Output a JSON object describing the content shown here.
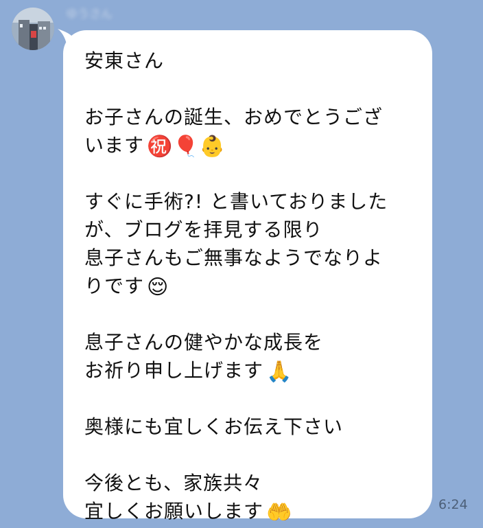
{
  "chat": {
    "sender_name": "ゆうさん",
    "timestamp": "6:24",
    "message_lines": [
      {
        "text": "安東さん",
        "emoji": ""
      },
      {
        "text": "",
        "emoji": ""
      },
      {
        "text": "お子さんの誕生、おめでとうござ",
        "emoji": ""
      },
      {
        "text": "います",
        "emoji": "㊗️🎈👶"
      },
      {
        "text": "",
        "emoji": ""
      },
      {
        "text": "すぐに手術?! と書いておりました",
        "emoji": ""
      },
      {
        "text": "が、ブログを拝見する限り",
        "emoji": ""
      },
      {
        "text": "息子さんもご無事なようでなりよ",
        "emoji": ""
      },
      {
        "text": "りです",
        "emoji": "😌"
      },
      {
        "text": "",
        "emoji": ""
      },
      {
        "text": "息子さんの健やかな成長を",
        "emoji": ""
      },
      {
        "text": "お祈り申し上げます",
        "emoji": "🙏"
      },
      {
        "text": "",
        "emoji": ""
      },
      {
        "text": "奥様にも宜しくお伝え下さい",
        "emoji": ""
      },
      {
        "text": "",
        "emoji": ""
      },
      {
        "text": "今後とも、家族共々",
        "emoji": ""
      },
      {
        "text": "宜しくお願いします",
        "emoji": "🤲"
      }
    ]
  }
}
